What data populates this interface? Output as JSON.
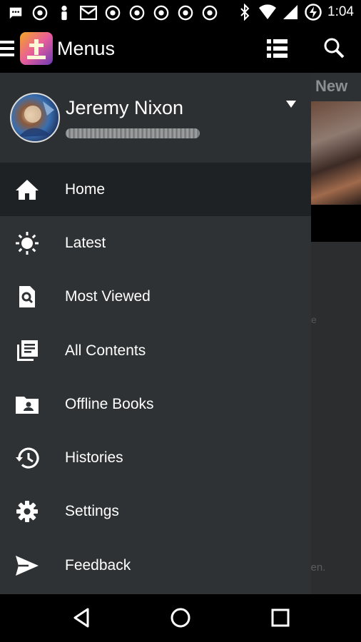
{
  "status_bar": {
    "time": "1:04",
    "left_icons": [
      "message-icon",
      "chrome-icon",
      "figure-icon",
      "mail-icon",
      "chrome-icon",
      "chrome-icon",
      "chrome-icon",
      "chrome-icon",
      "chrome-icon",
      "chrome-icon"
    ],
    "right_icons": [
      "bluetooth-icon",
      "wifi-icon",
      "signal-icon",
      "battery-charging-icon"
    ]
  },
  "app_bar": {
    "title": "Menus"
  },
  "background": {
    "tab_label": "New",
    "faint_text_1": "e",
    "faint_text_2": "ven."
  },
  "drawer": {
    "user_name": "Jeremy Nixon",
    "menu": [
      {
        "label": "Home",
        "icon": "home-icon",
        "active": true
      },
      {
        "label": "Latest",
        "icon": "brightness-icon",
        "active": false
      },
      {
        "label": "Most Viewed",
        "icon": "find-in-page-icon",
        "active": false
      },
      {
        "label": "All Contents",
        "icon": "library-books-icon",
        "active": false
      },
      {
        "label": "Offline Books",
        "icon": "account-folder-icon",
        "active": false
      },
      {
        "label": "Histories",
        "icon": "history-icon",
        "active": false
      },
      {
        "label": "Settings",
        "icon": "gear-icon",
        "active": false
      },
      {
        "label": "Feedback",
        "icon": "send-icon",
        "active": false
      }
    ]
  },
  "colors": {
    "drawer_bg": "#2f3234",
    "active_item_bg": "#1f2224",
    "bar_bg": "#000000",
    "text": "#ffffff"
  }
}
